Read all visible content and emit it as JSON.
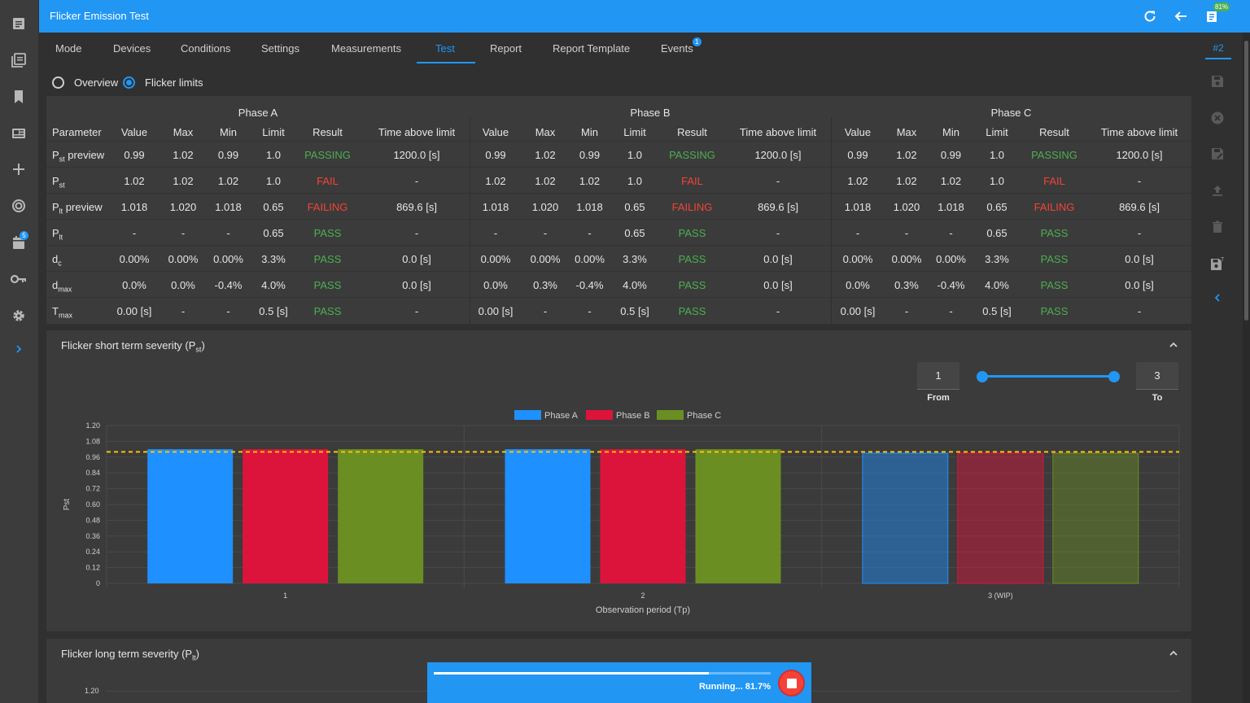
{
  "header": {
    "title": "Flicker Emission Test",
    "battery_badge": "81%"
  },
  "icons": {
    "refresh": "refresh-icon",
    "back": "arrow-left-icon",
    "battery": "battery-icon"
  },
  "left_rail": {
    "items": [
      "document-icon",
      "library-icon",
      "bookmark-icon",
      "news-icon",
      "plus-icon",
      "target-icon",
      "calendar-icon",
      "key-icon",
      "gear-icon",
      "chevron-right-icon"
    ],
    "calendar_badge": "5"
  },
  "right_rail": {
    "tab": "#2",
    "items": [
      "save-icon",
      "close-circle-icon",
      "save-edit-icon",
      "upload-icon",
      "trash-icon",
      "save-as-icon",
      "chevron-left-icon"
    ]
  },
  "tabs": [
    {
      "label": "Mode"
    },
    {
      "label": "Devices"
    },
    {
      "label": "Conditions"
    },
    {
      "label": "Settings"
    },
    {
      "label": "Measurements"
    },
    {
      "label": "Test"
    },
    {
      "label": "Report"
    },
    {
      "label": "Report Template"
    },
    {
      "label": "Events",
      "badge": "1"
    }
  ],
  "view": {
    "overview": "Overview",
    "flicker_limits": "Flicker limits",
    "selected": "Flicker limits"
  },
  "table": {
    "phases": [
      "Phase A",
      "Phase B",
      "Phase C"
    ],
    "param_header": "Parameter",
    "columns": [
      "Value",
      "Max",
      "Min",
      "Limit",
      "Result",
      "Time above limit"
    ],
    "rows": [
      {
        "param": "P",
        "sub": "st",
        "suffix": " preview",
        "phases": [
          [
            "0.99",
            "1.02",
            "0.99",
            "1.0",
            "PASSING",
            "1200.0 [s]"
          ],
          [
            "0.99",
            "1.02",
            "0.99",
            "1.0",
            "PASSING",
            "1200.0 [s]"
          ],
          [
            "0.99",
            "1.02",
            "0.99",
            "1.0",
            "PASSING",
            "1200.0 [s]"
          ]
        ]
      },
      {
        "param": "P",
        "sub": "st",
        "suffix": "",
        "phases": [
          [
            "1.02",
            "1.02",
            "1.02",
            "1.0",
            "FAIL",
            "-"
          ],
          [
            "1.02",
            "1.02",
            "1.02",
            "1.0",
            "FAIL",
            "-"
          ],
          [
            "1.02",
            "1.02",
            "1.02",
            "1.0",
            "FAIL",
            "-"
          ]
        ]
      },
      {
        "param": "P",
        "sub": "lt",
        "suffix": " preview",
        "phases": [
          [
            "1.018",
            "1.020",
            "1.018",
            "0.65",
            "FAILING",
            "869.6 [s]"
          ],
          [
            "1.018",
            "1.020",
            "1.018",
            "0.65",
            "FAILING",
            "869.6 [s]"
          ],
          [
            "1.018",
            "1.020",
            "1.018",
            "0.65",
            "FAILING",
            "869.6 [s]"
          ]
        ]
      },
      {
        "param": "P",
        "sub": "lt",
        "suffix": "",
        "phases": [
          [
            "-",
            "-",
            "-",
            "0.65",
            "PASS",
            "-"
          ],
          [
            "-",
            "-",
            "-",
            "0.65",
            "PASS",
            "-"
          ],
          [
            "-",
            "-",
            "-",
            "0.65",
            "PASS",
            "-"
          ]
        ]
      },
      {
        "param": "d",
        "sub": "c",
        "suffix": "",
        "phases": [
          [
            "0.00%",
            "0.00%",
            "0.00%",
            "3.3%",
            "PASS",
            "0.0 [s]"
          ],
          [
            "0.00%",
            "0.00%",
            "0.00%",
            "3.3%",
            "PASS",
            "0.0 [s]"
          ],
          [
            "0.00%",
            "0.00%",
            "0.00%",
            "3.3%",
            "PASS",
            "0.0 [s]"
          ]
        ]
      },
      {
        "param": "d",
        "sub": "max",
        "suffix": "",
        "phases": [
          [
            "0.0%",
            "0.0%",
            "-0.4%",
            "4.0%",
            "PASS",
            "0.0 [s]"
          ],
          [
            "0.0%",
            "0.3%",
            "-0.4%",
            "4.0%",
            "PASS",
            "0.0 [s]"
          ],
          [
            "0.0%",
            "0.3%",
            "-0.4%",
            "4.0%",
            "PASS",
            "0.0 [s]"
          ]
        ]
      },
      {
        "param": "T",
        "sub": "max",
        "suffix": "",
        "phases": [
          [
            "0.00 [s]",
            "-",
            "-",
            "0.5 [s]",
            "PASS",
            "-"
          ],
          [
            "0.00 [s]",
            "-",
            "-",
            "0.5 [s]",
            "PASS",
            "-"
          ],
          [
            "0.00 [s]",
            "-",
            "-",
            "0.5 [s]",
            "PASS",
            "-"
          ]
        ]
      }
    ]
  },
  "pst_card": {
    "title_main": "Flicker short term severity (P",
    "title_sub": "st",
    "title_end": ")",
    "range_from": "1",
    "range_to": "3",
    "from_label": "From",
    "to_label": "To",
    "slider_from": 1,
    "slider_to": 3,
    "slider_max": 3
  },
  "plt_card": {
    "title_main": "Flicker long term severity (P",
    "title_sub": "lt",
    "title_end": ")",
    "first_tick": "1.20"
  },
  "chart_data": {
    "type": "bar",
    "categories": [
      "1",
      "2",
      "3 (WIP)"
    ],
    "series": [
      {
        "name": "Phase A",
        "values": [
          1.02,
          1.02,
          0.99
        ],
        "color": "#1e90ff"
      },
      {
        "name": "Phase B",
        "values": [
          1.02,
          1.02,
          0.99
        ],
        "color": "#dc143c"
      },
      {
        "name": "Phase C",
        "values": [
          1.02,
          1.02,
          0.99
        ],
        "color": "#6b8e23"
      }
    ],
    "limit": 1.0,
    "limit_color": "#ffc107",
    "xlabel": "Observation period (Tp)",
    "ylabel": "Pst",
    "ylim": [
      0,
      1.2
    ],
    "yticks": [
      "0",
      "0.12",
      "0.24",
      "0.36",
      "0.48",
      "0.60",
      "0.72",
      "0.84",
      "0.96",
      "1.08",
      "1.20"
    ],
    "wip_category": "3 (WIP)",
    "legend_position": "top-center",
    "grid": true
  },
  "progress": {
    "text": "Running... 81.7%",
    "value": 0.817
  }
}
